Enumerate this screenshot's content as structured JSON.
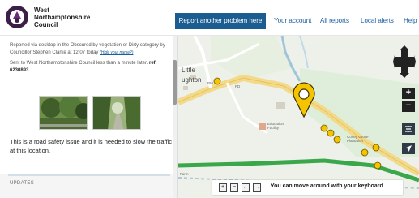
{
  "header": {
    "logo_lines": [
      "West",
      "Northamptonshire",
      "Council"
    ],
    "cta_label": "Report another problem here",
    "nav_links": [
      "Your account",
      "All reports",
      "Local alerts",
      "Help"
    ]
  },
  "report": {
    "meta_part1": "Reported via desktop in the Obscured by vegetation or Dirty category by Councillor Stephen Clarke at 12:07 today",
    "meta_link": "(Hide your name?)",
    "sent_text": "Sent to West Northamptonshire Council less than a minute later.",
    "ref_label": "ref: 6230893.",
    "description": "This is a road safety issue and it is needed to slow the traffic at this location.",
    "updates_label": "UPDATES"
  },
  "map": {
    "place_label_1": "Little",
    "place_label_2": "ughton",
    "pw_label": "PW",
    "pd_label": "PD",
    "edu_label": "Education Facility",
    "plantation_label": "Coney Grove Plantation",
    "farm_label": "Farm",
    "zoom_in": "+",
    "zoom_out": "−",
    "keyboard_hint": "You can move around with your keyboard",
    "kbd_keys": [
      "+",
      "−",
      "←",
      "→"
    ]
  },
  "colors": {
    "brand_blue": "#1b5c91",
    "link_blue": "#1a5ea0",
    "pin_yellow": "#f5c400",
    "road_green": "#3aa84a"
  }
}
